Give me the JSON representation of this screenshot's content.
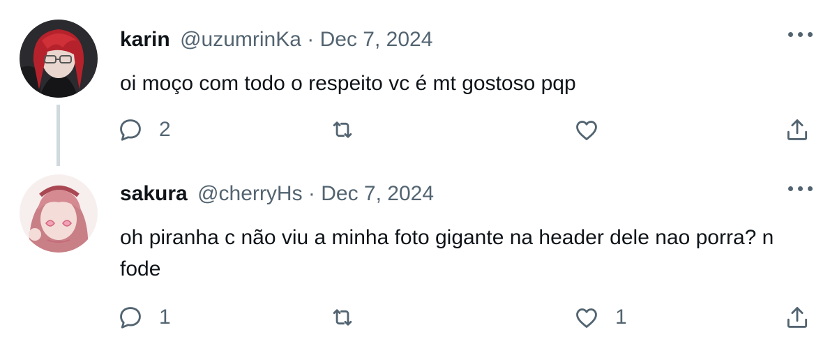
{
  "tweets": [
    {
      "display_name": "karin",
      "handle": "@uzumrinKa",
      "separator": "·",
      "date": "Dec 7, 2024",
      "text": "oi moço com todo o respeito vc é mt gostoso pqp",
      "reply_count": "2",
      "retweet_count": "",
      "like_count": "",
      "avatar_icon": "avatar-red-hair-glasses"
    },
    {
      "display_name": "sakura",
      "handle": "@cherryHs",
      "separator": "·",
      "date": "Dec 7, 2024",
      "text": "oh piranha c não viu a minha foto gigante na header dele nao porra? n fode",
      "reply_count": "1",
      "retweet_count": "",
      "like_count": "1",
      "avatar_icon": "avatar-pink-hair-heart-glasses"
    }
  ],
  "colors": {
    "text": "#0f1419",
    "secondary": "#536471",
    "thread_line": "#cfd9de"
  }
}
